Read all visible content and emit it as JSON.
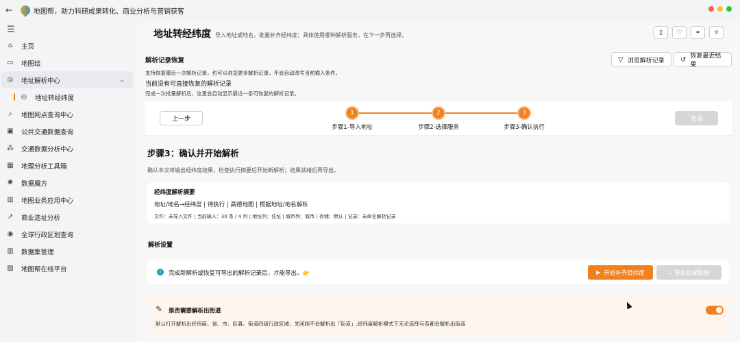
{
  "window": {
    "title": "地图帮，助力科研成果转化、商业分析与营销获客",
    "traffic_colors": [
      "#ff5f57",
      "#febc2e",
      "#28c840"
    ]
  },
  "sidebar": {
    "items": [
      {
        "icon": "home-icon",
        "glyph": "⌂",
        "label": "主页"
      },
      {
        "icon": "map-icon",
        "glyph": "▭",
        "label": "地图绘"
      },
      {
        "icon": "address-parse-icon",
        "glyph": "◎",
        "label": "地址解析中心"
      },
      {
        "icon": "geocode-icon",
        "glyph": "◎",
        "label": "地址转经纬度"
      },
      {
        "icon": "search-icon",
        "glyph": "⌕",
        "label": "地图网点查询中心"
      },
      {
        "icon": "bus-icon",
        "glyph": "▣",
        "label": "公共交通数据查询"
      },
      {
        "icon": "traffic-icon",
        "glyph": "⁂",
        "label": "交通数据分析中心"
      },
      {
        "icon": "grid-icon",
        "glyph": "▦",
        "label": "地理分析工具箱"
      },
      {
        "icon": "magic-icon",
        "glyph": "✺",
        "label": "数据魔方"
      },
      {
        "icon": "chart-icon",
        "glyph": "▥",
        "label": "地图业务应用中心"
      },
      {
        "icon": "trend-icon",
        "glyph": "↗",
        "label": "商业选址分析"
      },
      {
        "icon": "globe-icon",
        "glyph": "◉",
        "label": "全球行政区划查询"
      },
      {
        "icon": "dataset-icon",
        "glyph": "▥",
        "label": "数据集管理"
      },
      {
        "icon": "platform-icon",
        "glyph": "▨",
        "label": "地图帮在线平台"
      }
    ]
  },
  "header": {
    "title": "地址转经纬度",
    "description": "导入地址或地名，批量补齐经纬度；具体使用哪种解析服务，在下一步再选择。"
  },
  "recovery": {
    "title": "解析记录恢复",
    "desc": "支持恢复最近一次解析记录，也可以浏览更多解析记录，不会自动改写当前输入条件。",
    "status": "当前没有可直接恢复的解析记录",
    "hint": "完成一次批量解析后，这里会自动显示最近一条可恢复的解析记录。",
    "browse_label": "浏览解析记录",
    "restore_label": "恢复最近结果"
  },
  "stepper": {
    "prev_label": "上一步",
    "done_label": "完成",
    "steps": [
      {
        "num": "1",
        "label": "步骤1-导入地址"
      },
      {
        "num": "2",
        "label": "步骤2-选择服务"
      },
      {
        "num": "3",
        "label": "步骤3-确认执行"
      }
    ]
  },
  "step3": {
    "title": "步骤3：确认并开始解析",
    "desc": "确认本次将输出经纬度结果，检查执行摘要后开始新解析；结果就绪后再导出。"
  },
  "summary": {
    "title": "经纬度解析摘要",
    "line1": "地址/地名→经纬度 | 待执行 | 高德地图 | 根据地址/地名解析",
    "line2": "文件：未导入文件 | 当前输入：30 条 / 4 列 | 地址列：住址 | 城市列：城市 | 存储：默认 | 记录：未命名解析记录"
  },
  "settings": {
    "title": "解析设置",
    "export_hint": "完成新解析或恢复可导出的解析记录后，才能导出。👉",
    "start_label": "开始补齐经纬度",
    "export_label": "导出结果数据",
    "street_title": "是否需要解析出街道",
    "street_desc": "默认打开解析出经纬度、省、市、区县、街道四级行政区域，关闭则不会解析出「街道」,经纬度解析模式下无论选择与否都会解析出街道",
    "street_enabled": true
  },
  "colors": {
    "accent": "#f0811d",
    "disabled": "#d6d6d6",
    "info": "#1aa3b5"
  }
}
